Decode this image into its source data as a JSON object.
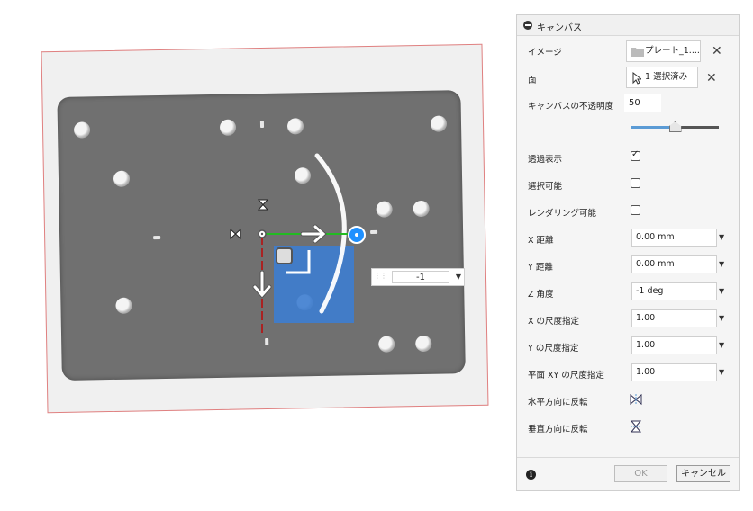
{
  "dialog": {
    "title": "キャンバス",
    "image_label": "イメージ",
    "image_value": "プレート_1....",
    "face_label": "面",
    "face_value": "1 選択済み",
    "opacity_label": "キャンバスの不透明度",
    "opacity_value": "50",
    "opacity_level": 0.5,
    "show_through_label": "透過表示",
    "show_through_checked": true,
    "selectable_label": "選択可能",
    "selectable_checked": false,
    "render_label": "レンダリング可能",
    "render_checked": false,
    "x_distance_label": "X 距離",
    "x_distance_value": "0.00 mm",
    "y_distance_label": "Y 距離",
    "y_distance_value": "0.00 mm",
    "z_angle_label": "Z 角度",
    "z_angle_value": "-1 deg",
    "x_scale_label": "X の尺度指定",
    "x_scale_value": "1.00",
    "y_scale_label": "Y の尺度指定",
    "y_scale_value": "1.00",
    "xy_scale_label": "平面 XY の尺度指定",
    "xy_scale_value": "1.00",
    "flip_h_label": "水平方向に反転",
    "flip_v_label": "垂直方向に反転",
    "ok_label": "OK",
    "cancel_label": "キャンセル"
  },
  "viewport": {
    "angle_input_value": "-1"
  },
  "colors": {
    "accent": "#1e90ff",
    "x_axis": "#22bb22",
    "y_axis": "#aa2222",
    "selection": "#3d7dd0",
    "canvas_border": "#e08080",
    "plate": "#707070"
  },
  "icons": [
    "collapse-icon",
    "folder-icon",
    "cursor-icon",
    "close-icon",
    "checkbox-icon",
    "dropdown-arrow-icon",
    "flip-horizontal-icon",
    "flip-vertical-icon",
    "info-icon"
  ]
}
